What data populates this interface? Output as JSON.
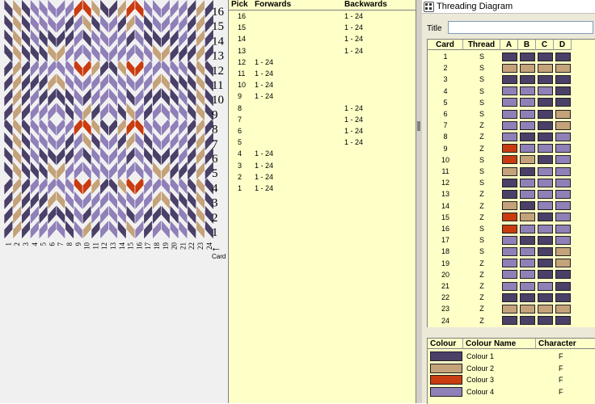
{
  "pattern": {
    "pick_labels": [
      "1",
      "2",
      "3",
      "4",
      "5",
      "6",
      "7",
      "8",
      "9",
      "10",
      "11",
      "12",
      "13",
      "14",
      "15",
      "16"
    ],
    "card_labels": [
      "1",
      "2",
      "3",
      "4",
      "5",
      "6",
      "7",
      "8",
      "9",
      "10",
      "11",
      "12",
      "13",
      "14",
      "15",
      "16",
      "17",
      "18",
      "19",
      "20",
      "21",
      "22",
      "23",
      "24"
    ],
    "card_axis_label": "Card",
    "arrow_glyph": "←"
  },
  "picks": {
    "headers": {
      "pick": "Pick",
      "forwards": "Forwards",
      "backwards": "Backwards"
    },
    "rows": [
      {
        "pick": "16",
        "forwards": "",
        "backwards": "1 - 24"
      },
      {
        "pick": "15",
        "forwards": "",
        "backwards": "1 - 24"
      },
      {
        "pick": "14",
        "forwards": "",
        "backwards": "1 - 24"
      },
      {
        "pick": "13",
        "forwards": "",
        "backwards": "1 - 24"
      },
      {
        "pick": "12",
        "forwards": "1 - 24",
        "backwards": ""
      },
      {
        "pick": "11",
        "forwards": "1 - 24",
        "backwards": ""
      },
      {
        "pick": "10",
        "forwards": "1 - 24",
        "backwards": ""
      },
      {
        "pick": "9",
        "forwards": "1 - 24",
        "backwards": ""
      },
      {
        "pick": "8",
        "forwards": "",
        "backwards": "1 - 24"
      },
      {
        "pick": "7",
        "forwards": "",
        "backwards": "1 - 24"
      },
      {
        "pick": "6",
        "forwards": "",
        "backwards": "1 - 24"
      },
      {
        "pick": "5",
        "forwards": "",
        "backwards": "1 - 24"
      },
      {
        "pick": "4",
        "forwards": "1 - 24",
        "backwards": ""
      },
      {
        "pick": "3",
        "forwards": "1 - 24",
        "backwards": ""
      },
      {
        "pick": "2",
        "forwards": "1 - 24",
        "backwards": ""
      },
      {
        "pick": "1",
        "forwards": "1 - 24",
        "backwards": ""
      }
    ]
  },
  "threading": {
    "window_title": "Threading Diagram",
    "title_label": "Title",
    "title_value": "",
    "headers": {
      "card": "Card",
      "thread": "Thread",
      "a": "A",
      "b": "B",
      "c": "C",
      "d": "D"
    },
    "cards": [
      {
        "card": "1",
        "thread": "S",
        "holes": [
          1,
          1,
          1,
          1
        ]
      },
      {
        "card": "2",
        "thread": "S",
        "holes": [
          2,
          2,
          2,
          2
        ]
      },
      {
        "card": "3",
        "thread": "S",
        "holes": [
          1,
          1,
          1,
          1
        ]
      },
      {
        "card": "4",
        "thread": "S",
        "holes": [
          4,
          4,
          4,
          1
        ]
      },
      {
        "card": "5",
        "thread": "S",
        "holes": [
          4,
          4,
          1,
          1
        ]
      },
      {
        "card": "6",
        "thread": "S",
        "holes": [
          4,
          4,
          1,
          2
        ]
      },
      {
        "card": "7",
        "thread": "Z",
        "holes": [
          4,
          4,
          1,
          2
        ]
      },
      {
        "card": "8",
        "thread": "Z",
        "holes": [
          4,
          1,
          1,
          4
        ]
      },
      {
        "card": "9",
        "thread": "Z",
        "holes": [
          3,
          4,
          4,
          4
        ]
      },
      {
        "card": "10",
        "thread": "S",
        "holes": [
          3,
          2,
          1,
          4
        ]
      },
      {
        "card": "11",
        "thread": "S",
        "holes": [
          2,
          1,
          4,
          4
        ]
      },
      {
        "card": "12",
        "thread": "S",
        "holes": [
          1,
          4,
          4,
          4
        ]
      },
      {
        "card": "13",
        "thread": "Z",
        "holes": [
          1,
          4,
          4,
          4
        ]
      },
      {
        "card": "14",
        "thread": "Z",
        "holes": [
          2,
          1,
          4,
          4
        ]
      },
      {
        "card": "15",
        "thread": "Z",
        "holes": [
          3,
          2,
          1,
          4
        ]
      },
      {
        "card": "16",
        "thread": "S",
        "holes": [
          3,
          4,
          4,
          4
        ]
      },
      {
        "card": "17",
        "thread": "S",
        "holes": [
          4,
          1,
          1,
          4
        ]
      },
      {
        "card": "18",
        "thread": "S",
        "holes": [
          4,
          4,
          1,
          2
        ]
      },
      {
        "card": "19",
        "thread": "Z",
        "holes": [
          4,
          4,
          1,
          2
        ]
      },
      {
        "card": "20",
        "thread": "Z",
        "holes": [
          4,
          4,
          1,
          1
        ]
      },
      {
        "card": "21",
        "thread": "Z",
        "holes": [
          4,
          4,
          4,
          1
        ]
      },
      {
        "card": "22",
        "thread": "Z",
        "holes": [
          1,
          1,
          1,
          1
        ]
      },
      {
        "card": "23",
        "thread": "Z",
        "holes": [
          2,
          2,
          2,
          2
        ]
      },
      {
        "card": "24",
        "thread": "Z",
        "holes": [
          1,
          1,
          1,
          1
        ]
      }
    ]
  },
  "colours": {
    "headers": {
      "colour": "Colour",
      "name": "Colour Name",
      "character": "Character"
    },
    "items": [
      {
        "name": "Colour 1",
        "character": "F",
        "hex": "#4a4068"
      },
      {
        "name": "Colour 2",
        "character": "F",
        "hex": "#c4a27a"
      },
      {
        "name": "Colour 3",
        "character": "F",
        "hex": "#c83c10"
      },
      {
        "name": "Colour 4",
        "character": "F",
        "hex": "#9080b8"
      }
    ]
  }
}
